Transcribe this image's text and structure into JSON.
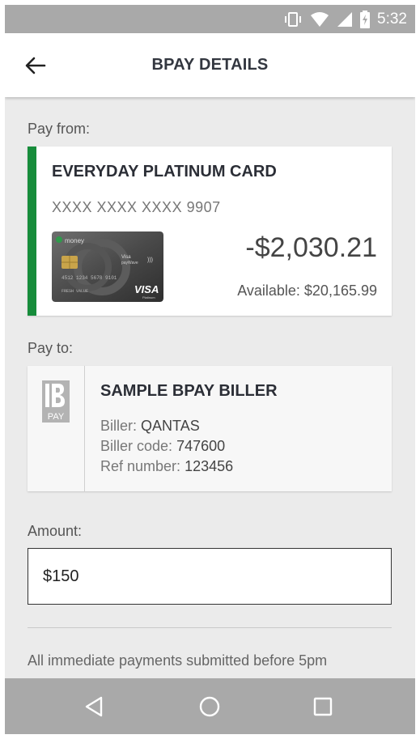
{
  "status_bar": {
    "time": "5:32"
  },
  "app_bar": {
    "title": "BPAY DETAILS"
  },
  "pay_from": {
    "label": "Pay from:",
    "card_name": "EVERYDAY PLATINUM CARD",
    "card_number": "XXXX XXXX XXXX 9907",
    "balance": "-$2,030.21",
    "available": "Available: $20,165.99",
    "accent_color": "#178c3b",
    "card_image_text": {
      "brand": "money",
      "network": "VISA",
      "tier": "Platinum",
      "contactless": "payWave"
    }
  },
  "pay_to": {
    "label": "Pay to:",
    "biller_name": "SAMPLE BPAY BILLER",
    "logo_text": "PAY",
    "biller_label": "Biller:",
    "biller_value": "QANTAS",
    "code_label": "Biller code:",
    "code_value": "747600",
    "ref_label": "Ref number:",
    "ref_value": "123456"
  },
  "amount": {
    "label": "Amount:",
    "value": "$150"
  },
  "note": "All immediate payments submitted before 5pm",
  "nav_bar": {
    "back": "back-triangle",
    "home": "home-circle",
    "recents": "recents-square"
  }
}
